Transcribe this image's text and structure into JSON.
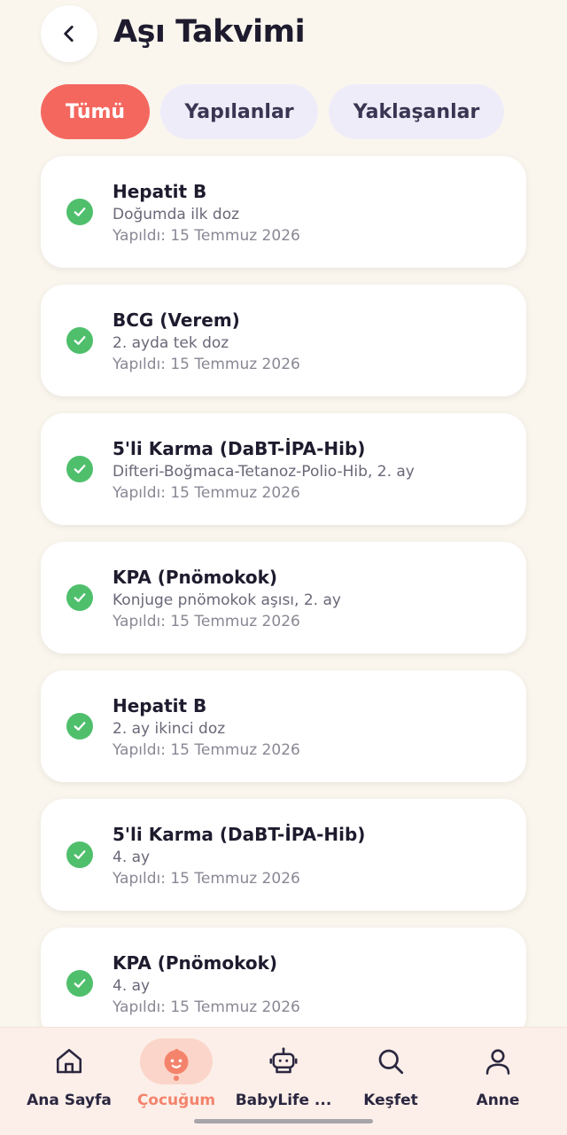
{
  "header": {
    "back_icon": "chevron-left-icon",
    "title": "Aşı Takvimi"
  },
  "filters": [
    {
      "label": "Tümü",
      "active": true
    },
    {
      "label": "Yapılanlar",
      "active": false
    },
    {
      "label": "Yaklaşanlar",
      "active": false
    }
  ],
  "vaccines": [
    {
      "name": "Hepatit B",
      "detail": "Doğumda ilk doz",
      "status": "Yapıldı: 15 Temmuz 2026"
    },
    {
      "name": "BCG (Verem)",
      "detail": "2. ayda tek doz",
      "status": "Yapıldı: 15 Temmuz 2026"
    },
    {
      "name": "5'li Karma (DaBT-İPA-Hib)",
      "detail": "Difteri-Boğmaca-Tetanoz-Polio-Hib, 2. ay",
      "status": "Yapıldı: 15 Temmuz 2026"
    },
    {
      "name": "KPA (Pnömokok)",
      "detail": "Konjuge pnömokok aşısı, 2. ay",
      "status": "Yapıldı: 15 Temmuz 2026"
    },
    {
      "name": "Hepatit B",
      "detail": "2. ay ikinci doz",
      "status": "Yapıldı: 15 Temmuz 2026"
    },
    {
      "name": "5'li Karma (DaBT-İPA-Hib)",
      "detail": "4. ay",
      "status": "Yapıldı: 15 Temmuz 2026"
    },
    {
      "name": "KPA (Pnömokok)",
      "detail": "4. ay",
      "status": "Yapıldı: 15 Temmuz 2026"
    }
  ],
  "status_icon": "check-circle-icon",
  "bottom_nav": [
    {
      "label": "Ana Sayfa",
      "icon": "home-icon",
      "active": false
    },
    {
      "label": "Çocuğum",
      "icon": "baby-face-icon",
      "active": true
    },
    {
      "label": "BabyLife ...",
      "icon": "robot-icon",
      "active": false
    },
    {
      "label": "Keşfet",
      "icon": "search-icon",
      "active": false
    },
    {
      "label": "Anne",
      "icon": "person-icon",
      "active": false
    }
  ],
  "colors": {
    "background": "#faf6ee",
    "accent": "#f4675f",
    "chip_inactive": "#efecf9",
    "success": "#4fbf6c",
    "nav_active": "#f4836c"
  }
}
